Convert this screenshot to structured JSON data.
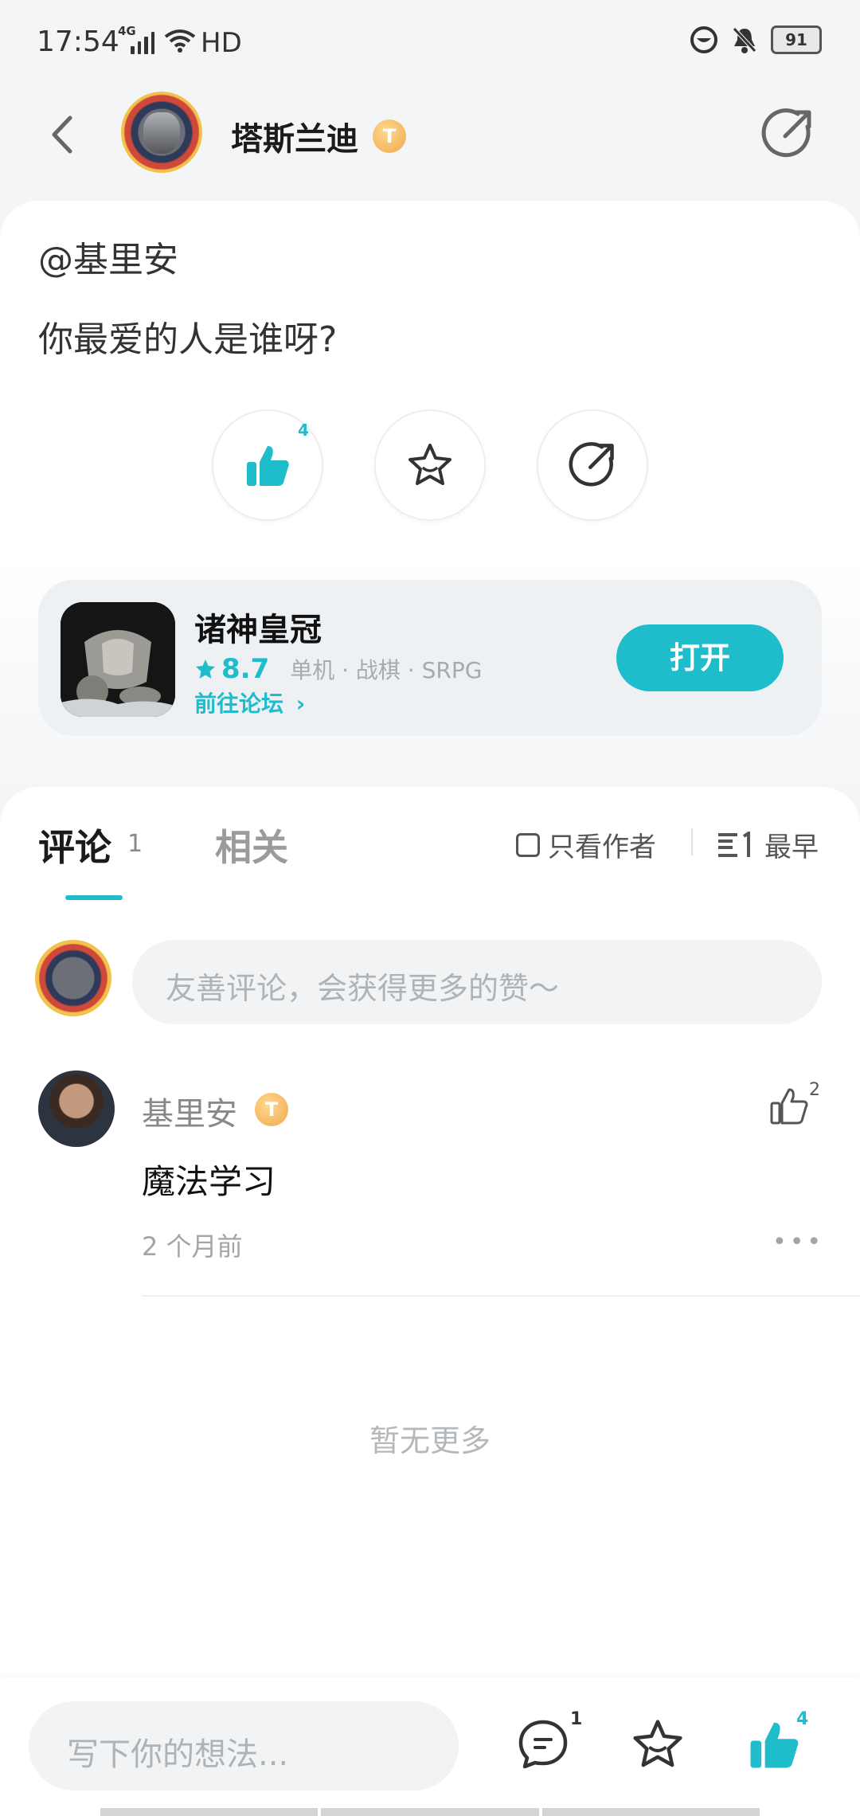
{
  "status_bar": {
    "time": "17:54",
    "network": "4G",
    "hd": "HD",
    "battery": "91"
  },
  "header": {
    "username": "塔斯兰迪",
    "badge": "T",
    "badge_level": "6"
  },
  "post": {
    "mention": "@基里安",
    "text": "你最爱的人是谁呀?",
    "like_count": "4"
  },
  "game": {
    "name": "诸神皇冠",
    "rating": "8.7",
    "tags": "单机 · 战棋 · SRPG",
    "forum_link": "前往论坛",
    "open_button": "打开"
  },
  "comments_section": {
    "tab_comments": "评论",
    "comment_count": "1",
    "tab_related": "相关",
    "only_author": "只看作者",
    "sort_label": "最早",
    "input_placeholder": "友善评论，会获得更多的赞～",
    "comments": [
      {
        "author": "基里安",
        "badge": "T",
        "badge_level": "6",
        "text": "魔法学习",
        "time": "2 个月前",
        "likes": "2"
      }
    ],
    "no_more": "暂无更多"
  },
  "bottom_bar": {
    "placeholder": "写下你的想法...",
    "comment_count": "1",
    "like_count": "4"
  },
  "colors": {
    "accent": "#1fbccb",
    "background": "#f4f5f7"
  }
}
